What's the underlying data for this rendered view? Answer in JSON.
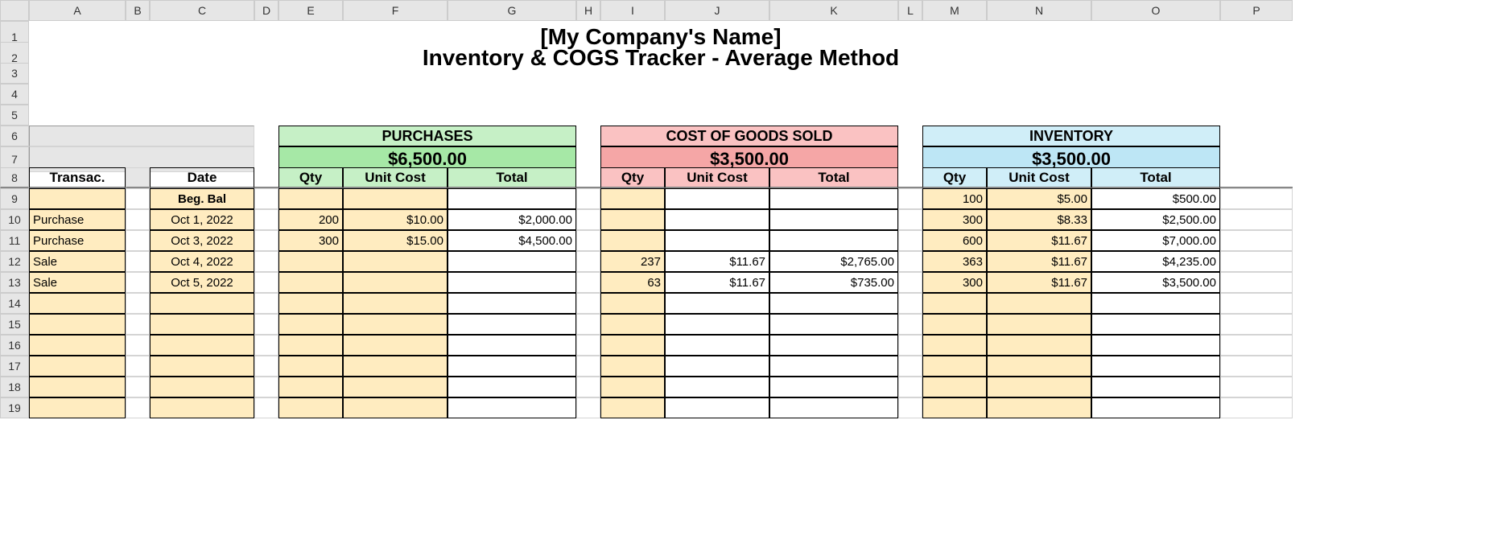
{
  "columns": [
    "",
    "A",
    "B",
    "C",
    "D",
    "E",
    "F",
    "G",
    "H",
    "I",
    "J",
    "K",
    "L",
    "M",
    "N",
    "O",
    "P"
  ],
  "rows": [
    "1",
    "2",
    "3",
    "4",
    "5",
    "6",
    "7",
    "8",
    "9",
    "10",
    "11",
    "12",
    "13",
    "14",
    "15",
    "16",
    "17",
    "18",
    "19"
  ],
  "title1": "[My Company's Name]",
  "title2": "Inventory & COGS Tracker - Average Method",
  "labels": {
    "transac": "Transac.",
    "date": "Date",
    "qty": "Qty",
    "unitcost": "Unit Cost",
    "total": "Total",
    "begbal": "Beg. Bal"
  },
  "sections": {
    "purchases": {
      "label": "PURCHASES",
      "total": "$6,500.00"
    },
    "cogs": {
      "label": "COST OF GOODS SOLD",
      "total": "$3,500.00"
    },
    "inventory": {
      "label": "INVENTORY",
      "total": "$3,500.00"
    }
  },
  "data": {
    "r9": {
      "transac": "",
      "date": "Beg. Bal",
      "p": [
        "",
        "",
        ""
      ],
      "c": [
        "",
        "",
        ""
      ],
      "i": [
        "100",
        "$5.00",
        "$500.00"
      ]
    },
    "r10": {
      "transac": "Purchase",
      "date": "Oct 1, 2022",
      "p": [
        "200",
        "$10.00",
        "$2,000.00"
      ],
      "c": [
        "",
        "",
        ""
      ],
      "i": [
        "300",
        "$8.33",
        "$2,500.00"
      ]
    },
    "r11": {
      "transac": "Purchase",
      "date": "Oct 3, 2022",
      "p": [
        "300",
        "$15.00",
        "$4,500.00"
      ],
      "c": [
        "",
        "",
        ""
      ],
      "i": [
        "600",
        "$11.67",
        "$7,000.00"
      ]
    },
    "r12": {
      "transac": "Sale",
      "date": "Oct 4, 2022",
      "p": [
        "",
        "",
        ""
      ],
      "c": [
        "237",
        "$11.67",
        "$2,765.00"
      ],
      "i": [
        "363",
        "$11.67",
        "$4,235.00"
      ]
    },
    "r13": {
      "transac": "Sale",
      "date": "Oct 5, 2022",
      "p": [
        "",
        "",
        ""
      ],
      "c": [
        "63",
        "$11.67",
        "$735.00"
      ],
      "i": [
        "300",
        "$11.67",
        "$3,500.00"
      ]
    }
  },
  "chart_data": {
    "type": "table",
    "title": "Inventory & COGS Tracker - Average Method",
    "totals": {
      "purchases": 6500.0,
      "cogs": 3500.0,
      "inventory": 3500.0
    },
    "columns": [
      "Transaction",
      "Date",
      "Purchase Qty",
      "Purchase Unit Cost",
      "Purchase Total",
      "COGS Qty",
      "COGS Unit Cost",
      "COGS Total",
      "Inv Qty",
      "Inv Unit Cost",
      "Inv Total"
    ],
    "rows": [
      [
        "Beg. Bal",
        "",
        null,
        null,
        null,
        null,
        null,
        null,
        100,
        5.0,
        500.0
      ],
      [
        "Purchase",
        "Oct 1, 2022",
        200,
        10.0,
        2000.0,
        null,
        null,
        null,
        300,
        8.33,
        2500.0
      ],
      [
        "Purchase",
        "Oct 3, 2022",
        300,
        15.0,
        4500.0,
        null,
        null,
        null,
        600,
        11.67,
        7000.0
      ],
      [
        "Sale",
        "Oct 4, 2022",
        null,
        null,
        null,
        237,
        11.67,
        2765.0,
        363,
        11.67,
        4235.0
      ],
      [
        "Sale",
        "Oct 5, 2022",
        null,
        null,
        null,
        63,
        11.67,
        735.0,
        300,
        11.67,
        3500.0
      ]
    ]
  }
}
